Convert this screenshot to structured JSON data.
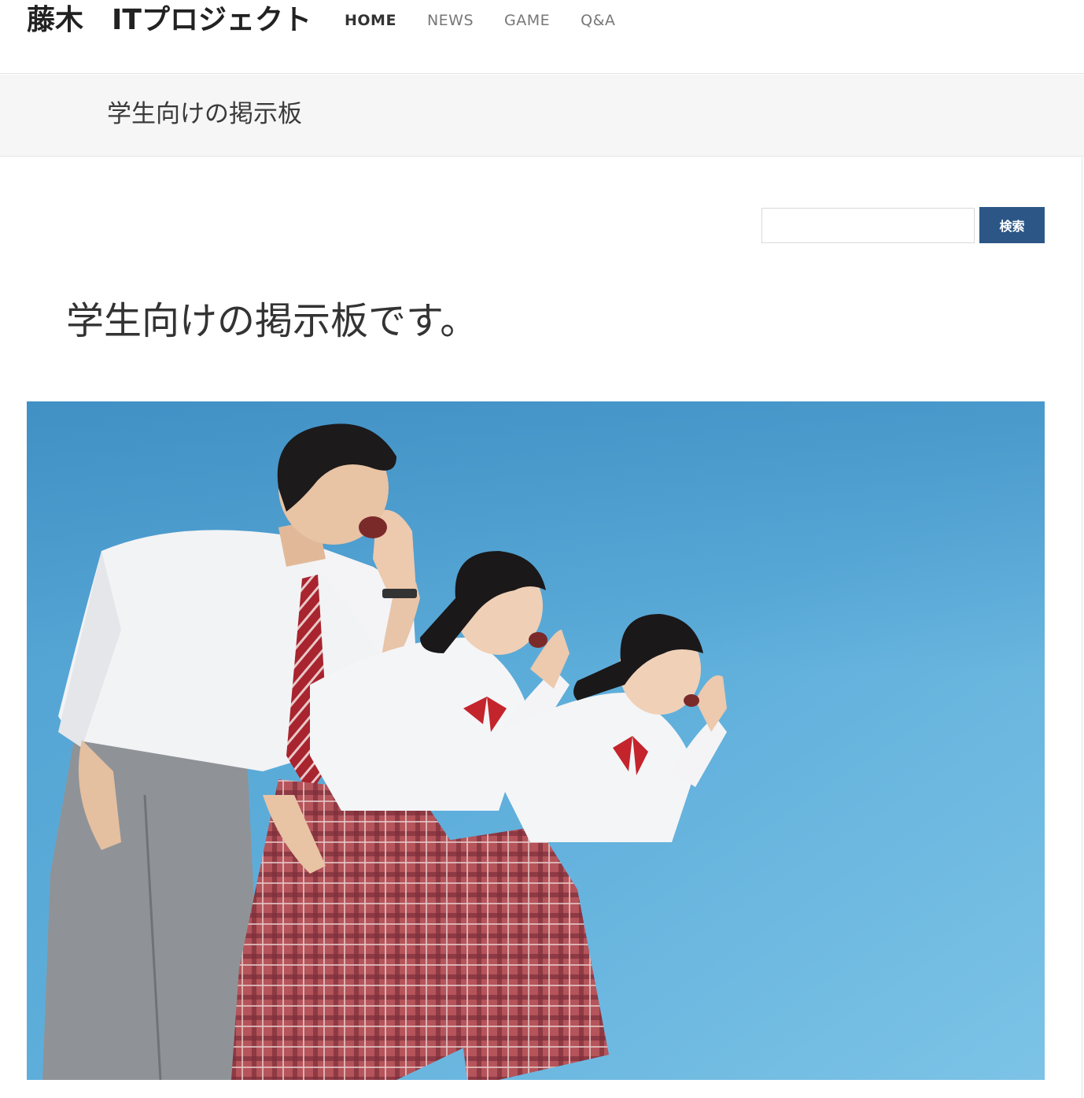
{
  "header": {
    "site_title": "藤木　ITプロジェクト",
    "nav": [
      {
        "label": "HOME"
      },
      {
        "label": "NEWS"
      },
      {
        "label": "GAME"
      },
      {
        "label": "Q&A"
      }
    ]
  },
  "banner": {
    "title": "学生向けの掲示板"
  },
  "search": {
    "placeholder": "",
    "button_label": "検索"
  },
  "main": {
    "heading": "学生向けの掲示板です。"
  },
  "hero": {
    "subject": "three students in school uniforms shouting with hands cupped against a blue sky",
    "sky_color": "#5cabd6"
  },
  "colors": {
    "button": "#2b5686",
    "banner_bg": "#f6f6f6"
  }
}
